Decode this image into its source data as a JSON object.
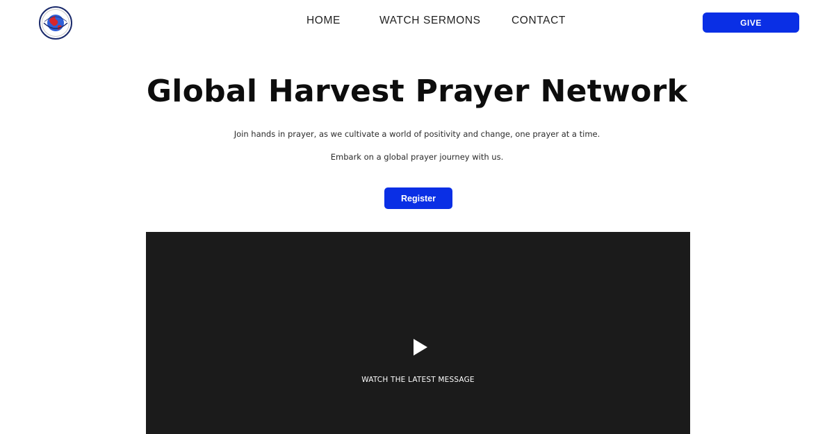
{
  "header": {
    "logo_icon": "globe-logo-icon",
    "nav": [
      {
        "label": "HOME"
      },
      {
        "label": "WATCH SERMONS"
      },
      {
        "label": "CONTACT"
      }
    ],
    "give_label": "GIVE"
  },
  "hero": {
    "title": "Global Harvest Prayer Network",
    "line1": "Join hands in prayer, as we cultivate a world of positivity and change, one prayer at a time.",
    "line2": "Embark on a global prayer journey with us.",
    "register_label": "Register"
  },
  "video": {
    "play_icon": "play-icon",
    "caption": "WATCH THE LATEST MESSAGE"
  },
  "colors": {
    "accent": "#0a2fe5",
    "video_bg": "#1b1b1b",
    "text": "#111111"
  }
}
